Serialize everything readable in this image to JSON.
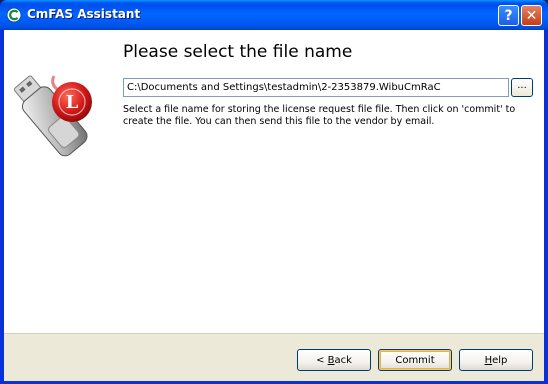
{
  "window": {
    "title": "CmFAS Assistant",
    "help_button": "?",
    "close_button": "✕"
  },
  "content": {
    "heading": "Please select the file name",
    "file_path": "C:\\Documents and Settings\\testadmin\\2-2353879.WibuCmRaC",
    "browse_label": "...",
    "description": "Select a file name for storing the license request file file. Then click on 'commit' to create the file. You can then send this file to the vendor by email."
  },
  "buttons": {
    "back_prefix": "< ",
    "back_mnemonic": "B",
    "back_rest": "ack",
    "commit": "Commit",
    "help_mnemonic": "H",
    "help_rest": "elp"
  }
}
